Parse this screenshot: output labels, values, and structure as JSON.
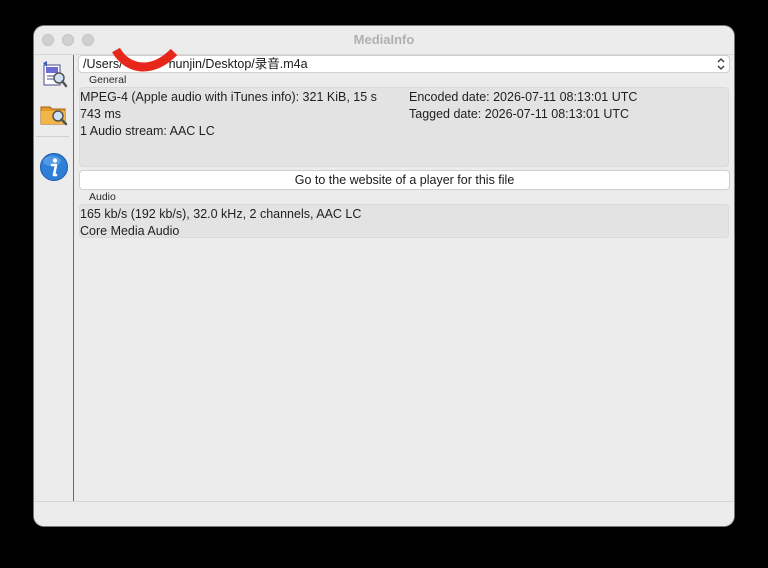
{
  "window": {
    "title": "MediaInfo"
  },
  "sidebar": {
    "items": [
      {
        "icon": "open-file-icon"
      },
      {
        "icon": "open-folder-icon"
      },
      {
        "icon": "info-icon"
      }
    ]
  },
  "file_select": {
    "value_start": "/Users/",
    "value_end": "hunjin/Desktop/录音.m4a"
  },
  "general": {
    "label": "General",
    "left_lines": [
      "MPEG-4 (Apple audio with iTunes info): 321 KiB, 15 s",
      "743 ms",
      "1 Audio stream: AAC LC"
    ],
    "right_lines": [
      "Encoded date: 2026-07-11 08:13:01 UTC",
      "Tagged date: 2026-07-11 08:13:01 UTC"
    ]
  },
  "player_button": {
    "label": "Go to the website of a player for this file"
  },
  "audio": {
    "label": "Audio",
    "lines": [
      "165 kb/s (192 kb/s), 32.0 kHz, 2 channels, AAC LC",
      "Core Media Audio"
    ]
  },
  "colors": {
    "annotation": "#e8271b",
    "info_blue": "#2f7fd8"
  }
}
